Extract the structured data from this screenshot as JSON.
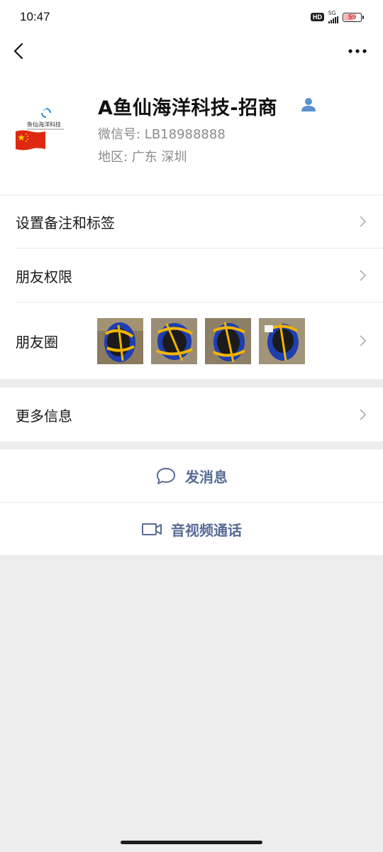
{
  "status_bar": {
    "time": "10:47",
    "hd": "HD",
    "network": "5G",
    "battery": "59",
    "battery_level": 0.59
  },
  "profile": {
    "name": "A鱼仙海洋科技-招商",
    "wechat_id": "微信号: LB18988888",
    "region": "地区: 广东  深圳",
    "avatar_caption": "鱼仙海洋科技"
  },
  "menu": {
    "remark_tags": "设置备注和标签",
    "permissions": "朋友权限",
    "moments": "朋友圈",
    "more_info": "更多信息"
  },
  "actions": {
    "message": "发消息",
    "call": "音视频通话"
  },
  "colors": {
    "link": "#576b95",
    "background": "#ededed",
    "contact_badge": "#5a8fd0"
  },
  "icons": [
    "back-icon",
    "more-icon",
    "contact-icon",
    "chevron-right-icon",
    "chat-bubble-icon",
    "video-camera-icon"
  ]
}
